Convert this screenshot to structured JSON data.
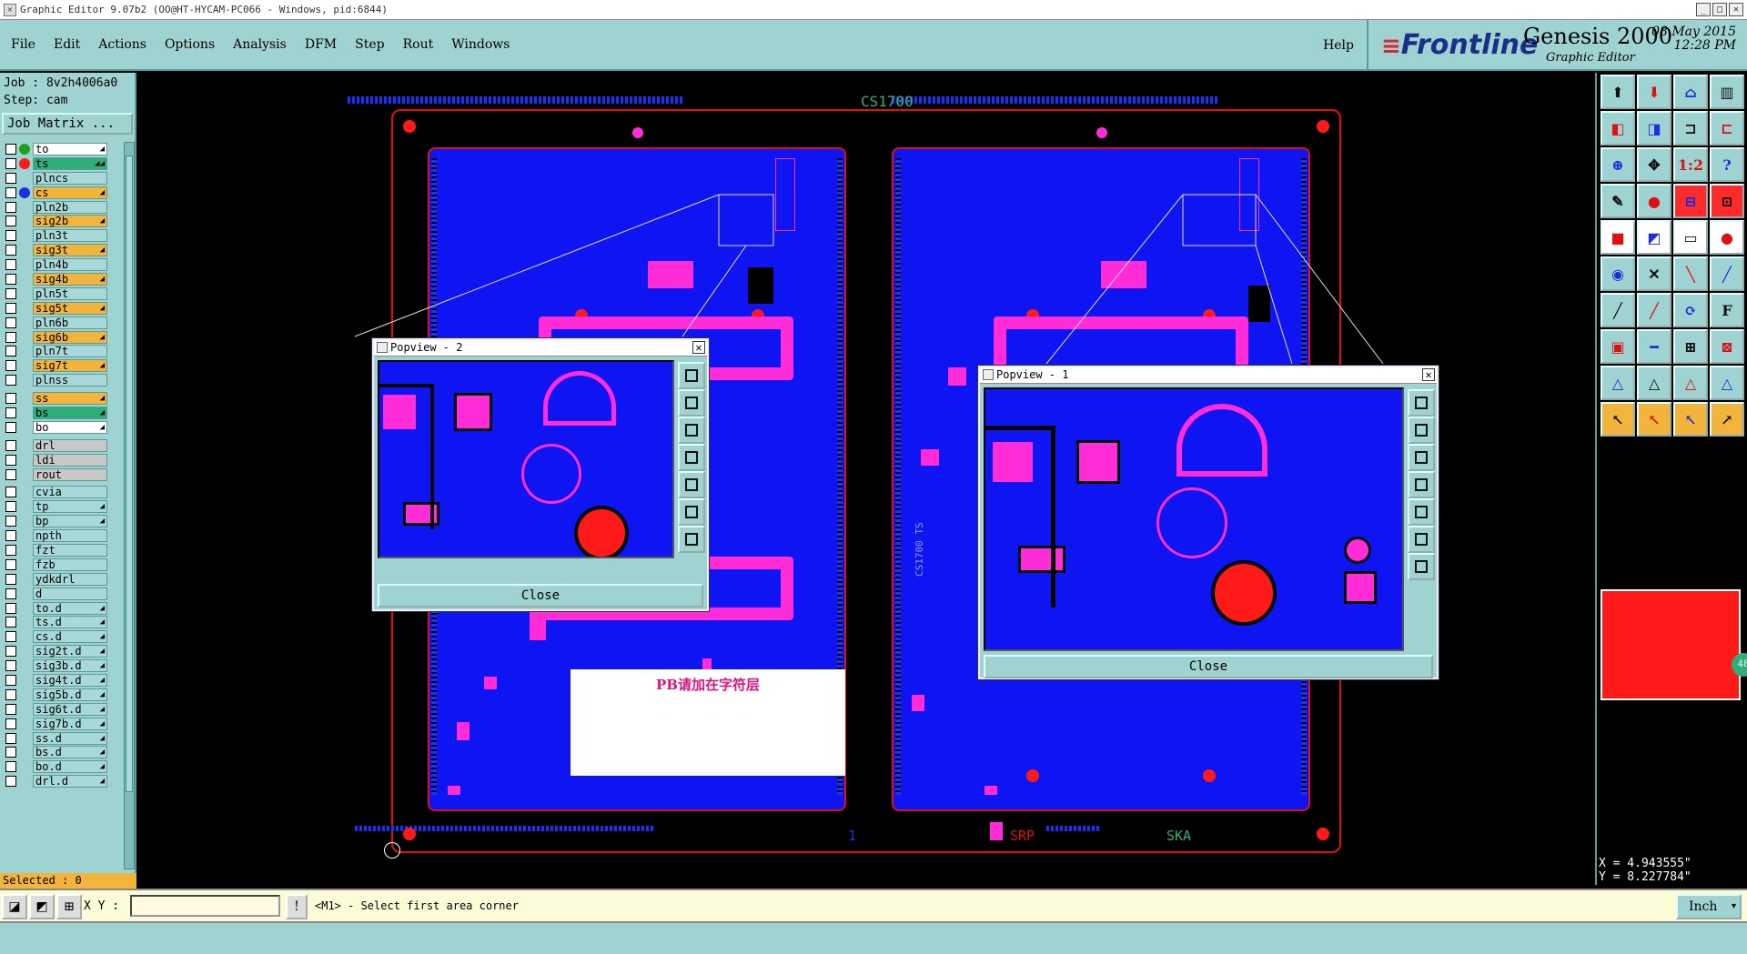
{
  "window": {
    "title": "Graphic Editor 9.07b2 (OO@HT-HYCAM-PC066 - Windows, pid:6844)"
  },
  "menu": {
    "items": [
      "File",
      "Edit",
      "Actions",
      "Options",
      "Analysis",
      "DFM",
      "Step",
      "Rout",
      "Windows"
    ],
    "help": "Help"
  },
  "brand": {
    "logo": "Frontline",
    "title": "Genesis 2000",
    "subtitle": "Graphic Editor",
    "date": "08 May 2015",
    "time": "12:28 PM"
  },
  "job": {
    "job_label": "Job : 8v2h4006a0",
    "step_label": "Step: cam",
    "matrix_button": "Job Matrix ..."
  },
  "layers": [
    {
      "name": "to",
      "style": "w",
      "dot": "#1ea11e",
      "tag": "◢"
    },
    {
      "name": "ts",
      "style": "g",
      "dot": "#ff1a1a",
      "tag": "◢◢"
    },
    {
      "name": "plncs",
      "style": ""
    },
    {
      "name": "cs",
      "style": "y",
      "dot": "#1a2fe0",
      "tag": "◢"
    },
    {
      "name": "pln2b",
      "style": ""
    },
    {
      "name": "sig2b",
      "style": "y",
      "tag": "◢"
    },
    {
      "name": "pln3t",
      "style": ""
    },
    {
      "name": "sig3t",
      "style": "y",
      "tag": "◢"
    },
    {
      "name": "pln4b",
      "style": ""
    },
    {
      "name": "sig4b",
      "style": "y",
      "tag": "◢"
    },
    {
      "name": "pln5t",
      "style": ""
    },
    {
      "name": "sig5t",
      "style": "y",
      "tag": "◢"
    },
    {
      "name": "pln6b",
      "style": ""
    },
    {
      "name": "sig6b",
      "style": "y",
      "tag": "◢"
    },
    {
      "name": "pln7t",
      "style": ""
    },
    {
      "name": "sig7t",
      "style": "y",
      "tag": "◢"
    },
    {
      "name": "plnss",
      "style": ""
    },
    {
      "sep": true
    },
    {
      "name": "ss",
      "style": "y",
      "tag": "◢"
    },
    {
      "name": "bs",
      "style": "g",
      "tag": "◢"
    },
    {
      "name": "bo",
      "style": "w",
      "tag": "◢"
    },
    {
      "sep": true
    },
    {
      "name": "drl",
      "style": "gy"
    },
    {
      "name": "ldi",
      "style": "gy"
    },
    {
      "name": "rout",
      "style": "gy"
    },
    {
      "sep": true
    },
    {
      "name": "cvia",
      "style": ""
    },
    {
      "name": "tp",
      "style": "",
      "tag": "◢"
    },
    {
      "name": "bp",
      "style": "",
      "tag": "◢"
    },
    {
      "name": "npth",
      "style": ""
    },
    {
      "name": "fzt",
      "style": ""
    },
    {
      "name": "fzb",
      "style": ""
    },
    {
      "name": "ydkdrl",
      "style": ""
    },
    {
      "name": "d",
      "style": ""
    },
    {
      "name": "to.d",
      "style": "",
      "tag": "◢"
    },
    {
      "name": "ts.d",
      "style": "",
      "tag": "◢"
    },
    {
      "name": "cs.d",
      "style": "",
      "tag": "◢"
    },
    {
      "name": "sig2t.d",
      "style": "",
      "tag": "◢"
    },
    {
      "name": "sig3b.d",
      "style": "",
      "tag": "◢"
    },
    {
      "name": "sig4t.d",
      "style": "",
      "tag": "◢"
    },
    {
      "name": "sig5b.d",
      "style": "",
      "tag": "◢"
    },
    {
      "name": "sig6t.d",
      "style": "",
      "tag": "◢"
    },
    {
      "name": "sig7b.d",
      "style": "",
      "tag": "◢"
    },
    {
      "name": "ss.d",
      "style": "",
      "tag": "◢"
    },
    {
      "name": "bs.d",
      "style": "",
      "tag": "◢"
    },
    {
      "name": "bo.d",
      "style": "",
      "tag": "◢"
    },
    {
      "name": "drl.d",
      "style": "",
      "tag": "◢"
    }
  ],
  "selected_label": "Selected : 0",
  "canvas": {
    "panel_label": "CS1700",
    "label_srp": "SRP",
    "label_ska": "SKA",
    "label_one": "1",
    "note": "PB请加在字符层",
    "vertical_label": "CS1700 TS"
  },
  "popups": [
    {
      "title": "Popview - 2",
      "close": "Close"
    },
    {
      "title": "Popview - 1",
      "close": "Close"
    }
  ],
  "coords": {
    "x": "X = 4.943555\"",
    "y": "Y = 8.227784\""
  },
  "bottom": {
    "xy_label": "X Y :",
    "xy_value": "",
    "prompt": "<M1> - Select first area corner",
    "unit": "Inch"
  },
  "colors": {
    "panel": "#9ed3d1",
    "board": "#0f14f2",
    "pad": "#ff2cd8",
    "outline": "#dd1111",
    "highlight": "#f2b43a"
  }
}
